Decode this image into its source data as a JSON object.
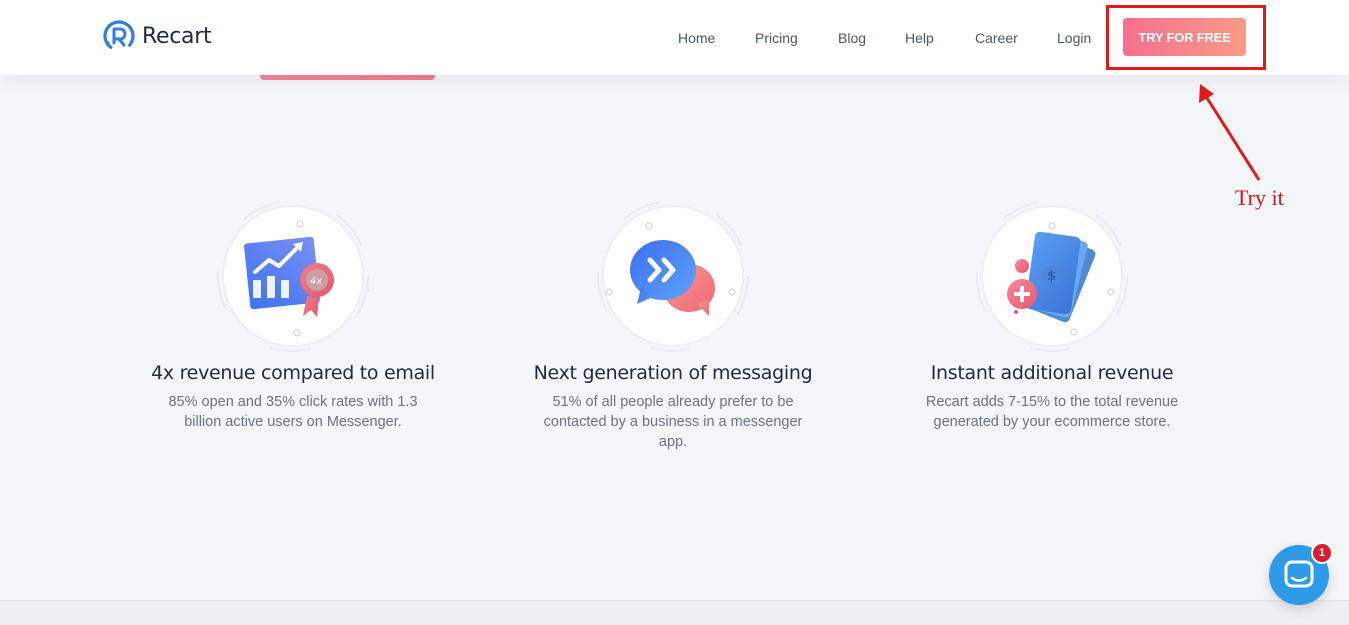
{
  "brand": {
    "name": "Recart"
  },
  "nav": {
    "items": [
      "Home",
      "Pricing",
      "Blog",
      "Help",
      "Career",
      "Login"
    ],
    "cta_label": "TRY FOR FREE"
  },
  "annotation": {
    "label": "Try it",
    "color": "#e01b1b"
  },
  "features": [
    {
      "icon": "growth-chart-icon",
      "title": "4x revenue compared to email",
      "description": "85% open and 35% click rates with 1.3 billion active users on Messenger."
    },
    {
      "icon": "chat-bubbles-icon",
      "title": "Next generation of messaging",
      "description": "51% of all people already prefer to be contacted by a business in a messenger app."
    },
    {
      "icon": "money-cards-icon",
      "title": "Instant additional revenue",
      "description": "Recart adds 7-15% to the total revenue generated by your ecommerce store."
    }
  ],
  "chat": {
    "badge_count": "1",
    "icon": "chat-icon"
  },
  "colors": {
    "accent": "#f5708f",
    "chat": "#2d9be8",
    "text": "#1f2a44"
  }
}
